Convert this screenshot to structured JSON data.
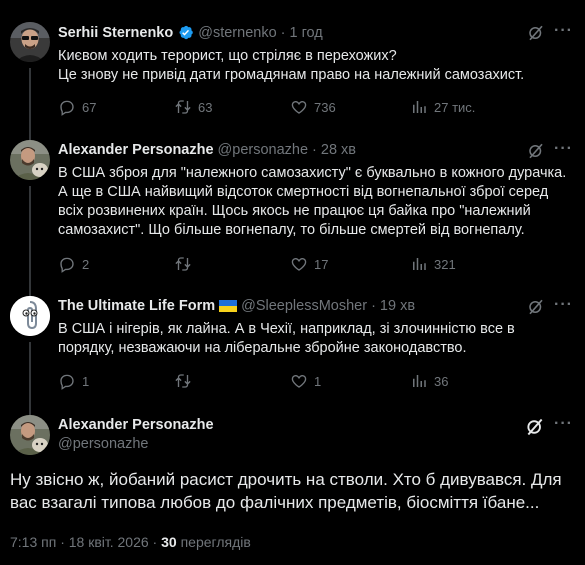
{
  "tweets": [
    {
      "name": "Serhii Sternenko",
      "handle": "@sternenko",
      "dot": "·",
      "time": "1 год",
      "lines": [
        "Києвом ходить терорист, що стріляє в перехожих?",
        "Це знову не привід дати громадянам право на належний самозахист."
      ],
      "replies": "67",
      "reposts": "63",
      "likes": "736",
      "views": "27 тис."
    },
    {
      "name": "Alexander Personazhe",
      "handle": "@personazhe",
      "dot": "·",
      "time": "28 хв",
      "lines": [
        "В США зброя для \"належного самозахисту\" є буквально в кожного дурачка.",
        "А ще в США найвищий відсоток смертності від вогнепальної зброї серед",
        "всіх розвинених країн. Щось якось не працює ця  байка про  \"належний",
        "самозахист\". Що більше вогнепалу, то більше смертей від вогнепалу."
      ],
      "replies": "2",
      "reposts": "",
      "likes": "17",
      "views": "321"
    },
    {
      "name": "The Ultimate Life Form",
      "handle": "@SleeplessMosher",
      "dot": "·",
      "time": "19 хв",
      "lines": [
        "В США і нігерів, як лайна. А в Чехії, наприклад, зі злочинністю все в",
        "порядку, незважаючи на ліберальне збройне законодавство."
      ],
      "replies": "1",
      "reposts": "",
      "likes": "1",
      "views": "36"
    }
  ],
  "main": {
    "name": "Alexander Personazhe",
    "handle": "@personazhe",
    "lines": [
      "Ну звісно ж, йобаний расист дрочить на стволи. Хто б дивувався. Для",
      "вас взагалі типова любов до фалічних предметів, біосміття їбане..."
    ],
    "timestamp": "7:13 пп · 18 квіт. 2026 · ",
    "views_count": "30",
    "views_label": " переглядів"
  },
  "icons": {
    "verified_badge": "verified-badge-icon",
    "grok": "grok-icon",
    "more": "more-icon",
    "reply": "reply-icon",
    "repost": "repost-icon",
    "like": "like-icon",
    "views": "views-icon",
    "flag": "ukraine-flag-icon"
  },
  "colors": {
    "background": "#000000",
    "text": "#e7e9ea",
    "muted": "#71767b",
    "verified": "#1d9bf0",
    "divider": "#2f3336"
  }
}
